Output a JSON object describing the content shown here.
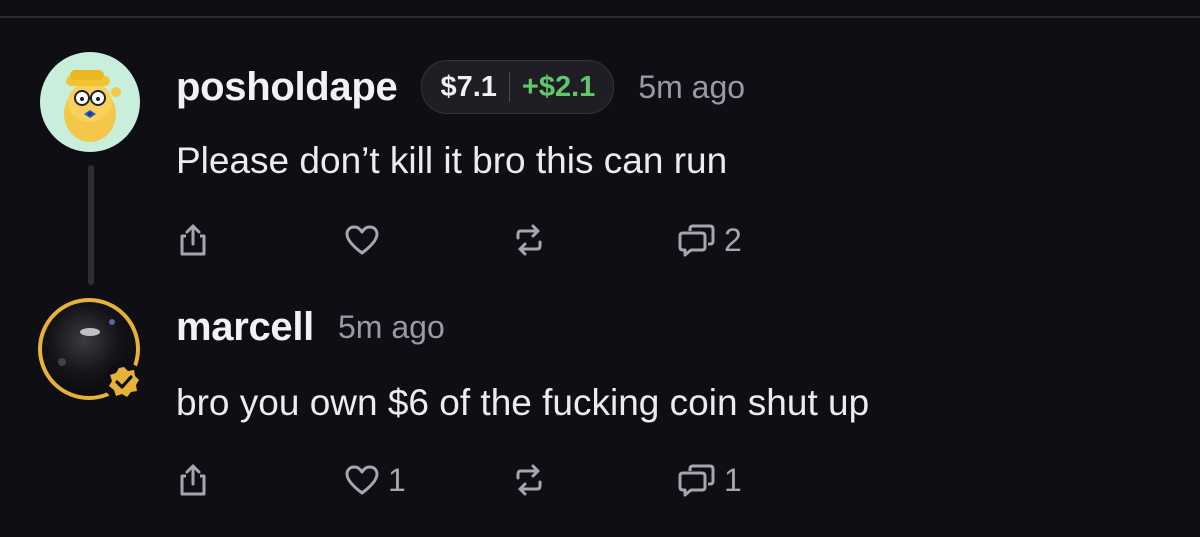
{
  "comments": [
    {
      "username": "posholdape",
      "holding_value": "$7.1",
      "holding_change": "+$2.1",
      "time": "5m ago",
      "text": "Please don’t kill it bro this can run",
      "actions": {
        "likes": "",
        "replies": "2"
      },
      "avatar": "cartoon-ape-avatar"
    },
    {
      "username": "marcell",
      "time": "5m ago",
      "text": "bro you own $6 of the fucking coin shut up",
      "actions": {
        "likes": "1",
        "replies": "1"
      },
      "avatar": "dark-photo-avatar",
      "badge": "verified-check-icon"
    }
  ],
  "colors": {
    "background": "#0f0e14",
    "positive_change": "#62c76b",
    "verified_badge": "#e6b23a",
    "muted_text": "#9a99a3"
  },
  "icons": [
    "share-icon",
    "heart-icon",
    "repost-icon",
    "reply-icon",
    "verified-check-icon"
  ]
}
